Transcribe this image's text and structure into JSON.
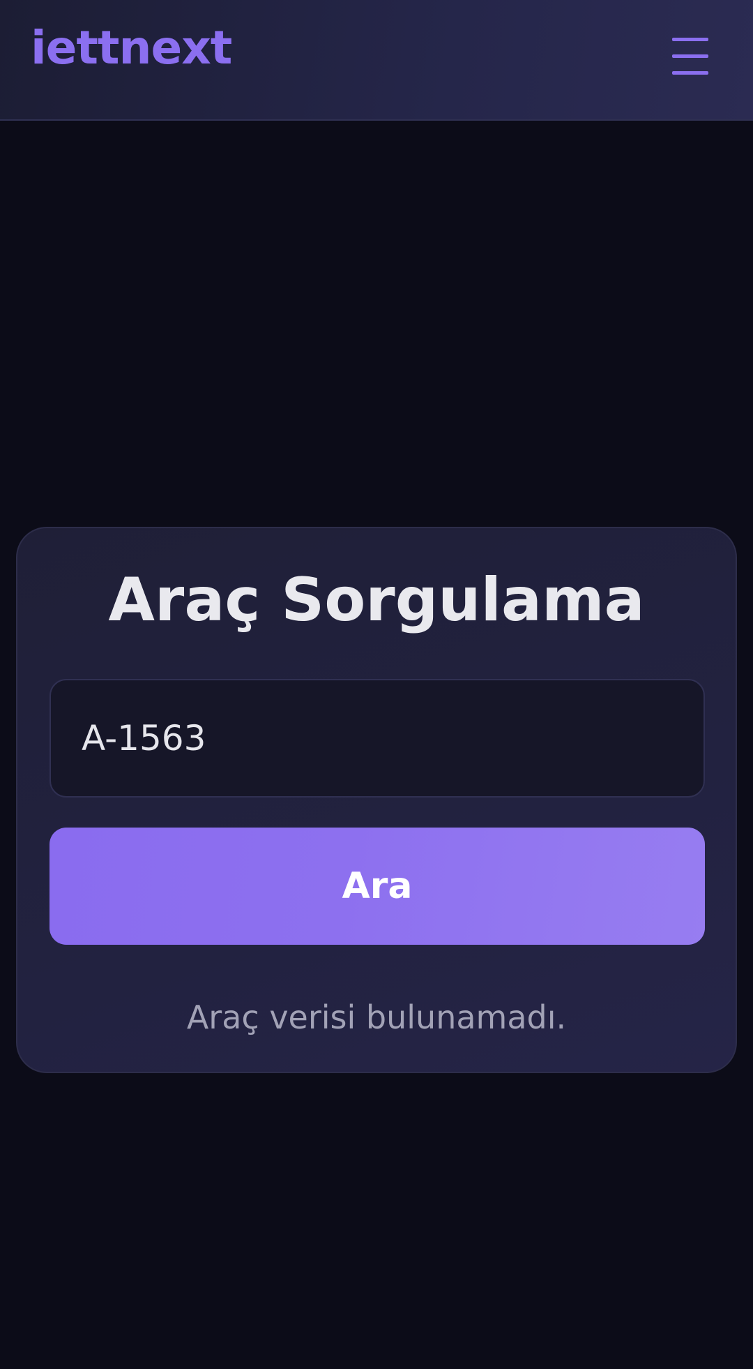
{
  "header": {
    "logo_text": "iettnext",
    "menu_icon": "hamburger-menu-icon"
  },
  "card": {
    "title": "Araç Sorgulama",
    "search_value": "A-1563",
    "search_button_label": "Ara",
    "status_message": "Araç verisi bulunamadı."
  },
  "colors": {
    "accent": "#8b6ff0",
    "background": "#0c0c18",
    "card": "#212140",
    "input_background": "#161628",
    "title_text": "#e9e9ee",
    "muted_text": "#a2a2b6"
  }
}
